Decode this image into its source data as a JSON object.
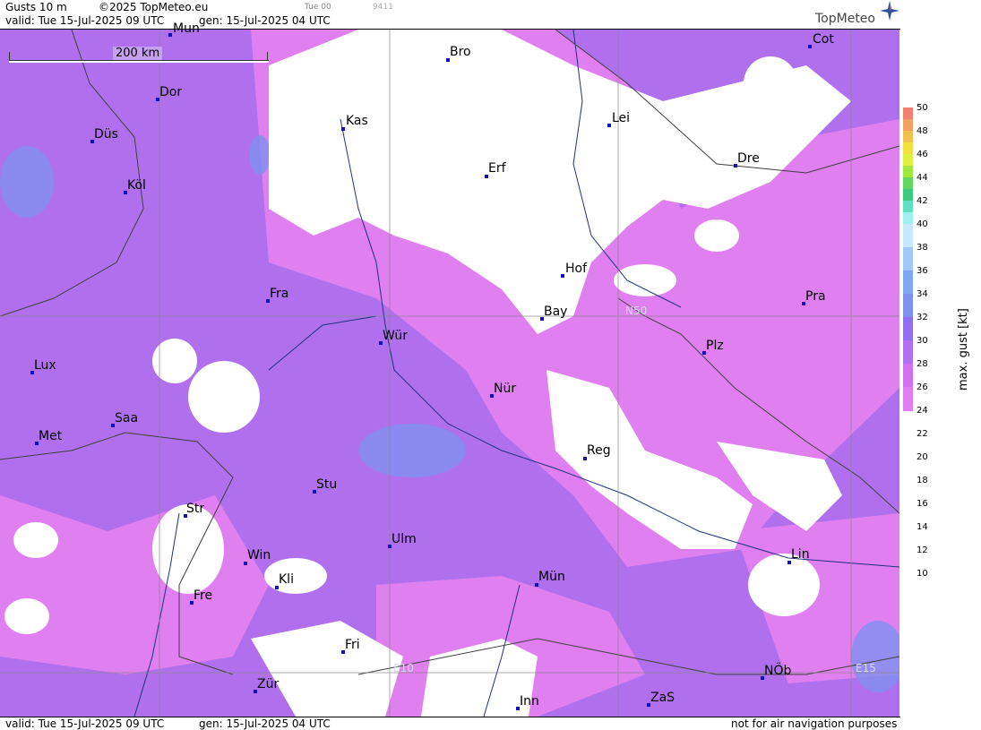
{
  "header": {
    "product": "Gusts 10 m",
    "copyright": "©2025 TopMeteo.eu",
    "run": "Tue 00",
    "code": "9411",
    "valid": "valid:  Tue  15-Jul-2025  09 UTC",
    "gen": "gen: 15-Jul-2025 04 UTC",
    "logo": "TopMeteo"
  },
  "footer": {
    "valid": "valid:  Tue  15-Jul-2025  09 UTC",
    "gen": "gen: 15-Jul-2025 04 UTC",
    "disclaimer": "not for air navigation purposes"
  },
  "scale": {
    "label": "200 km"
  },
  "grid_labels": [
    "N50",
    "E10",
    "E15"
  ],
  "cities": [
    {
      "name": "Mün",
      "short": "Mun"
    },
    {
      "name": "Bro"
    },
    {
      "name": "Cot"
    },
    {
      "name": "Dor"
    },
    {
      "name": "Kas"
    },
    {
      "name": "Lei"
    },
    {
      "name": "Düs"
    },
    {
      "name": "Erf"
    },
    {
      "name": "Dre"
    },
    {
      "name": "Köl"
    },
    {
      "name": "Hof"
    },
    {
      "name": "Fra"
    },
    {
      "name": "Bay"
    },
    {
      "name": "Pra"
    },
    {
      "name": "Wür"
    },
    {
      "name": "Plz"
    },
    {
      "name": "Lux"
    },
    {
      "name": "Nür"
    },
    {
      "name": "Saa"
    },
    {
      "name": "Met"
    },
    {
      "name": "Reg"
    },
    {
      "name": "Stu"
    },
    {
      "name": "Str"
    },
    {
      "name": "Ulm"
    },
    {
      "name": "Win"
    },
    {
      "name": "Lin"
    },
    {
      "name": "Kli"
    },
    {
      "name": "Mün2",
      "short": "Mün"
    },
    {
      "name": "Fre"
    },
    {
      "name": "Fri"
    },
    {
      "name": "NÖb"
    },
    {
      "name": "Zür"
    },
    {
      "name": "Inn"
    },
    {
      "name": "ZaS"
    }
  ],
  "legend": {
    "unit": "max. gust  [kt]",
    "ticks": [
      "50",
      "48",
      "46",
      "44",
      "42",
      "40",
      "38",
      "36",
      "34",
      "32",
      "30",
      "28",
      "26",
      "24",
      "22",
      "20",
      "18",
      "16",
      "14",
      "12",
      "10"
    ],
    "colors": [
      "#f08070",
      "#f0a060",
      "#f0c050",
      "#f0e040",
      "#e0f040",
      "#a0e840",
      "#60d860",
      "#40c880",
      "#60e0c0",
      "#a0f0f0",
      "#c8e8ff",
      "#a0c8f8",
      "#80a8f0",
      "#8090f0",
      "#9070f0",
      "#b070f0",
      "#d070f0",
      "#e080f0"
    ]
  }
}
